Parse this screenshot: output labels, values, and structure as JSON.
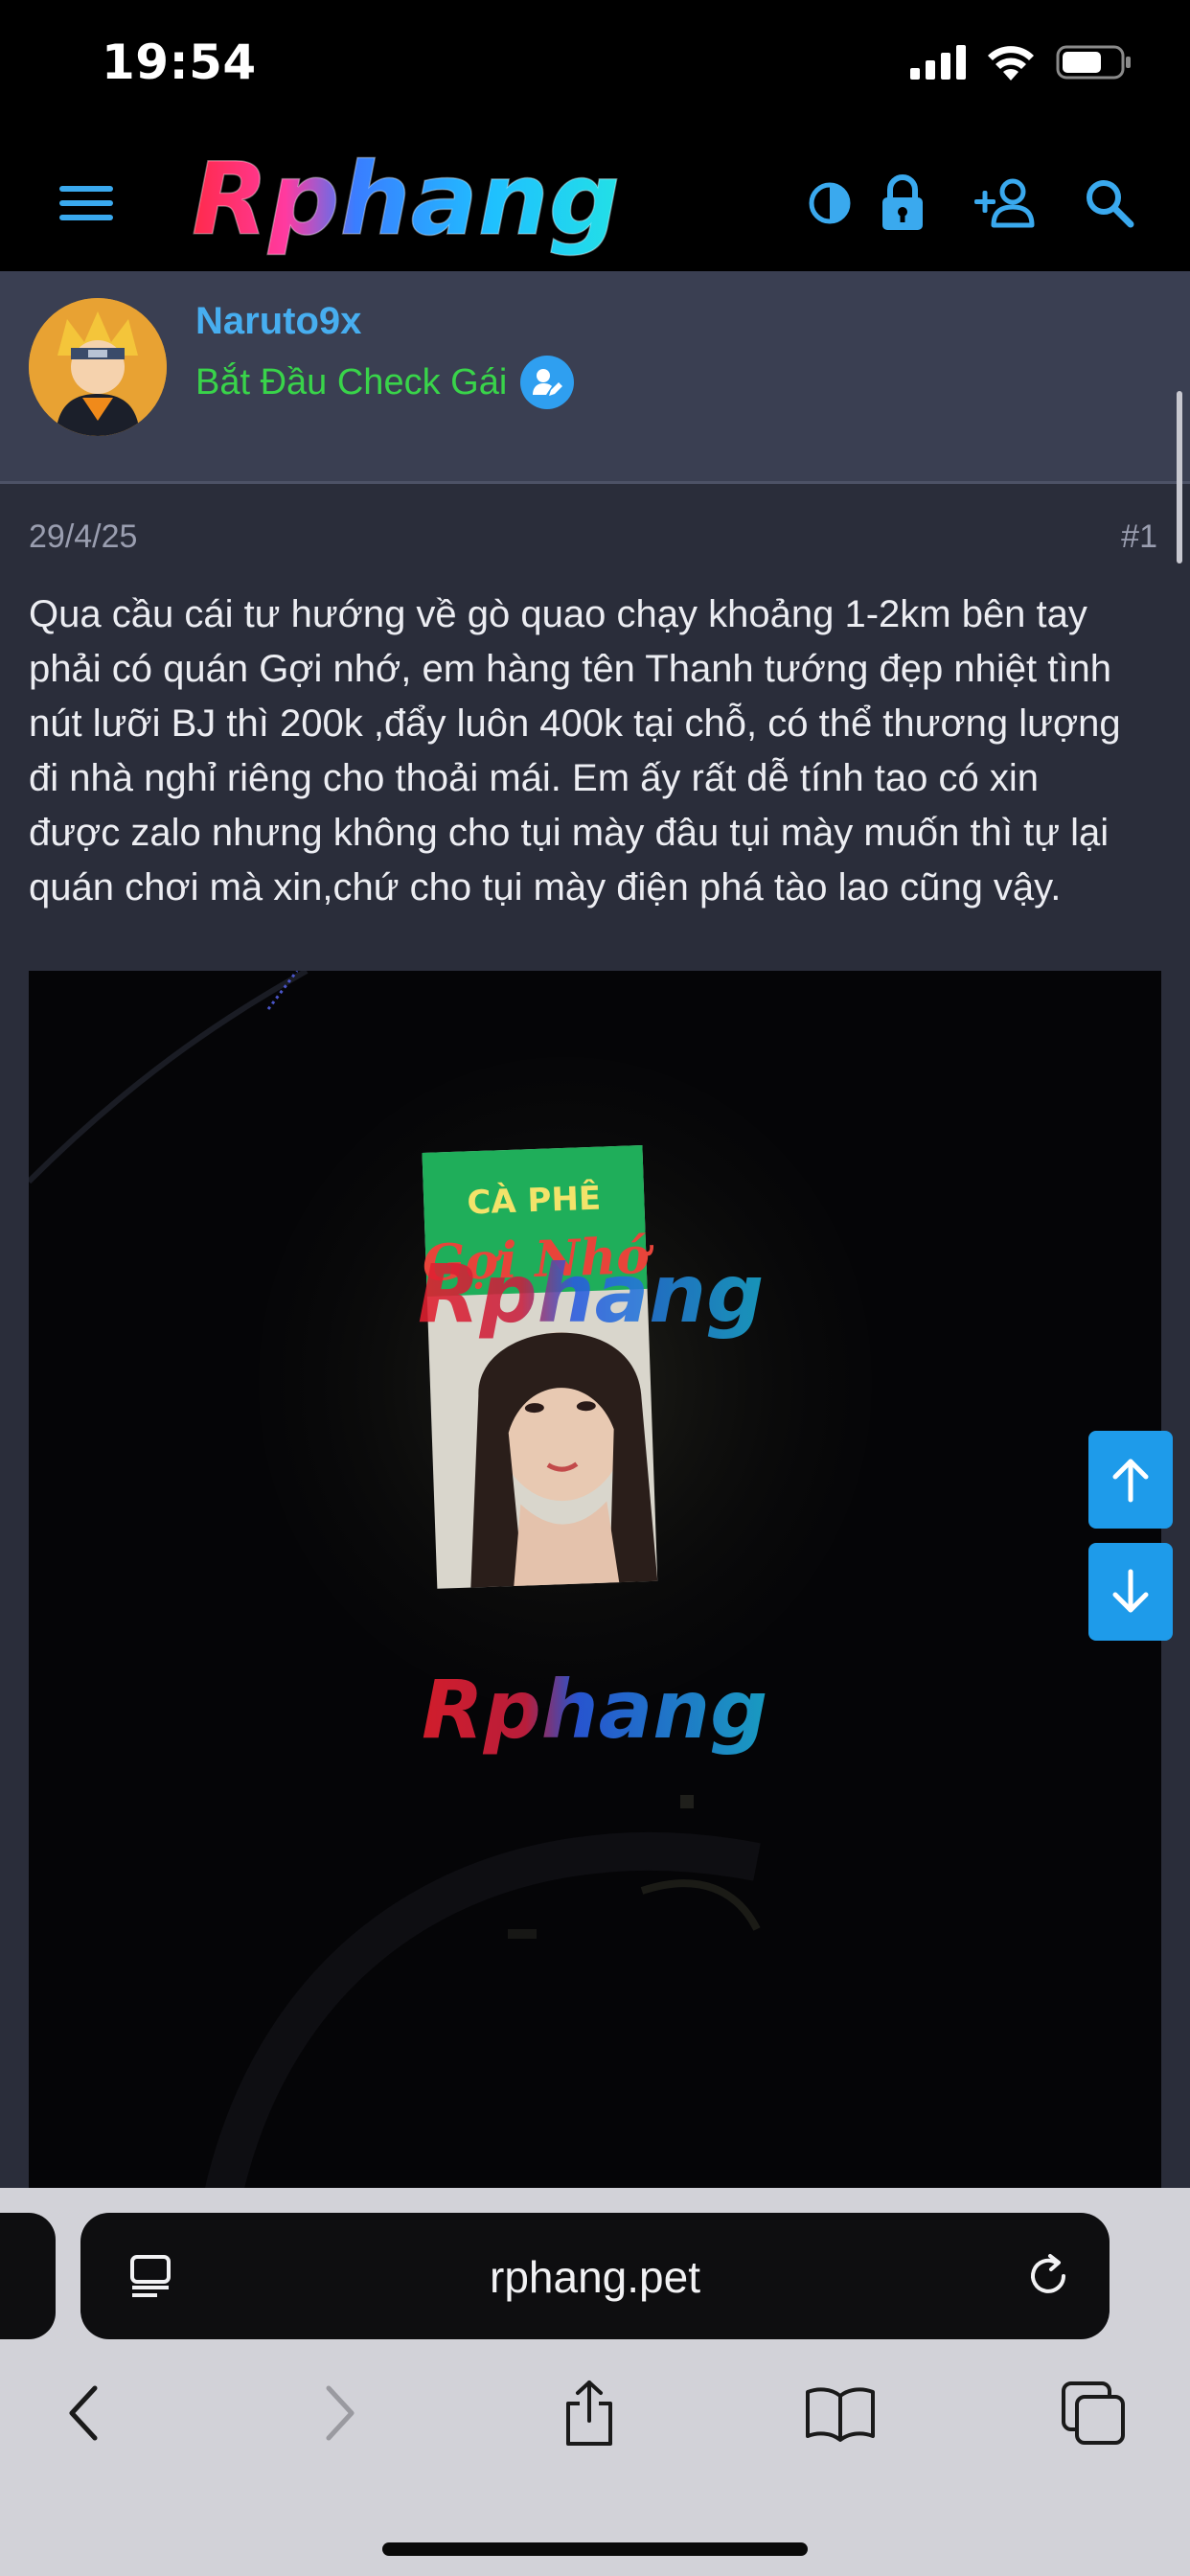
{
  "status_bar": {
    "time": "19:54"
  },
  "header": {
    "logo_text": "Rphang",
    "icons": [
      "menu-icon",
      "contrast-icon",
      "lock-icon",
      "add-user-icon",
      "search-icon"
    ]
  },
  "post": {
    "author": "Naruto9x",
    "user_title": "Bắt Đầu Check Gái",
    "date": "29/4/25",
    "number": "#1",
    "body_lines": [
      "Qua cầu cái tư hướng về gò quao chạy khoảng 1-2km bên tay",
      "phải có quán Gợi nhớ, em hàng tên Thanh tướng đẹp nhiệt tình",
      "nút lưỡi BJ thì 200k ,đẩy luôn 400k tại chỗ, có thể thương lượng",
      "đi nhà nghỉ riêng cho thoải mái. Em ấy rất dễ tính tao có xin",
      "được zalo nhưng không cho tụi mày đâu tụi mày muốn thì tự lại",
      "quán chơi mà xin,chứ cho tụi mày điện phá tào lao cũng vậy."
    ],
    "image": {
      "sign_top": "CÀ PHÊ",
      "sign_script": "Gợi Nhớ",
      "watermark": "Rphang"
    }
  },
  "browser": {
    "url": "rphang.pet"
  },
  "colors": {
    "accent": "#2f9ff0",
    "user_title": "#39d44a",
    "username": "#47aef0",
    "page_bg": "#2a2d3a"
  }
}
